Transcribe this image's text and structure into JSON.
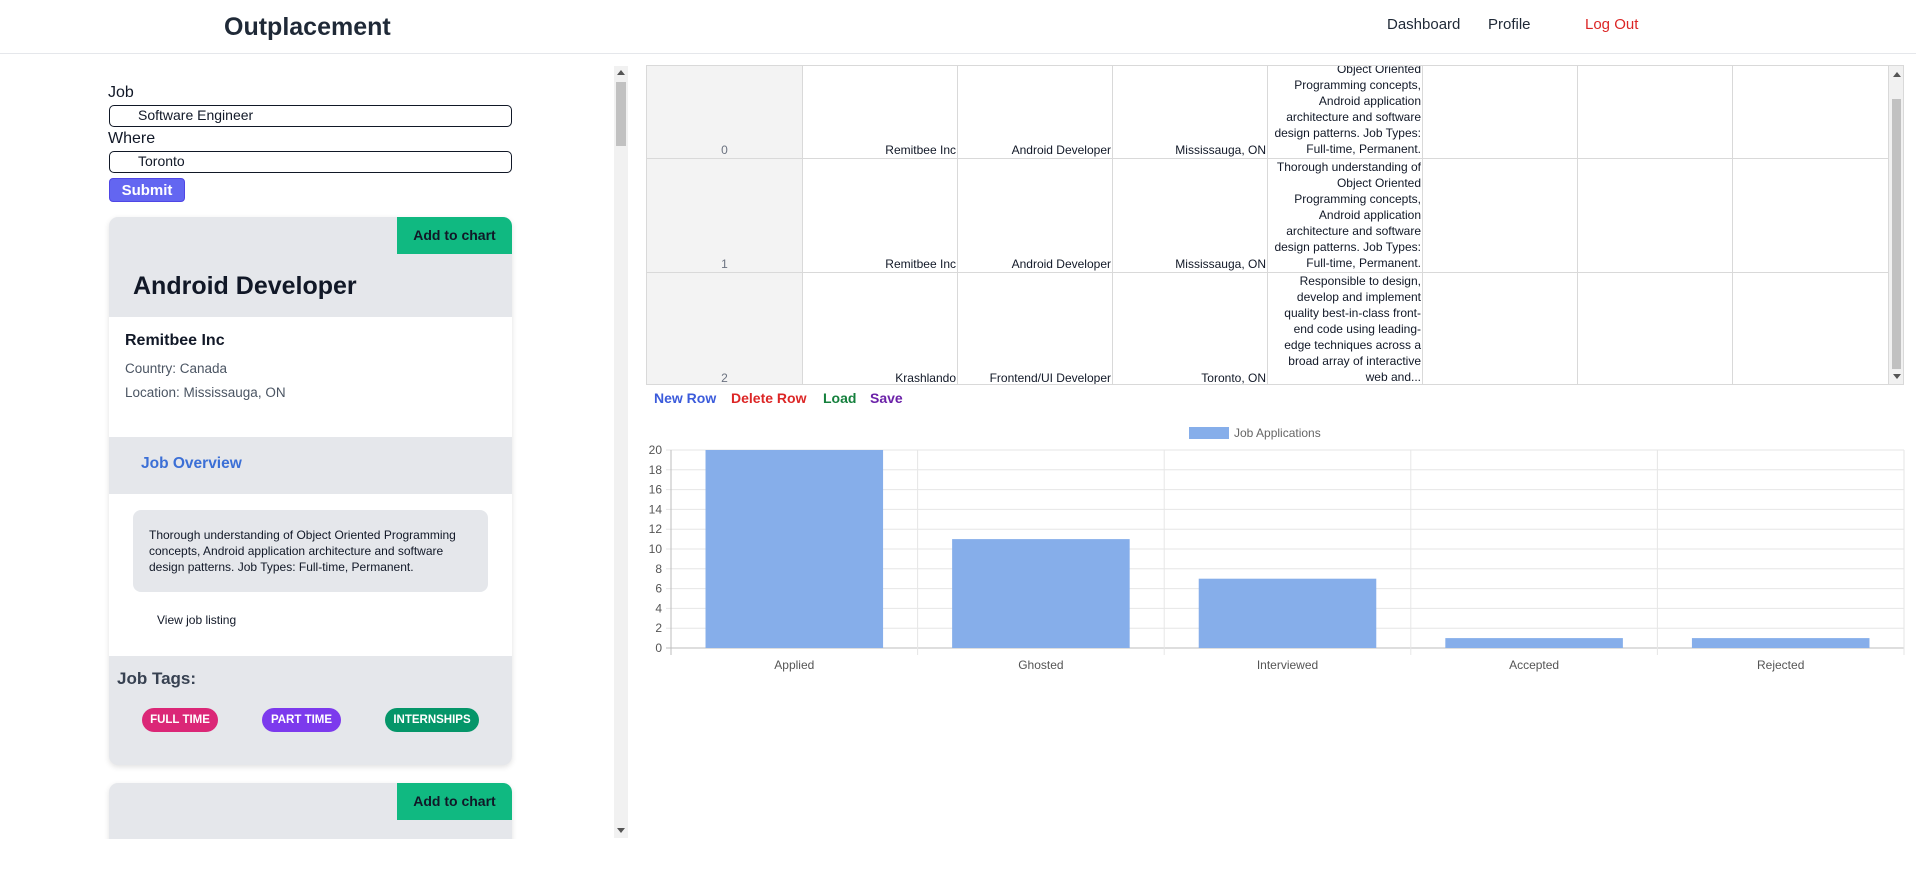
{
  "header": {
    "brand": "Outplacement",
    "nav": [
      "Dashboard",
      "Profile",
      "Log Out"
    ]
  },
  "search": {
    "job_label": "Job",
    "job_value": "Software Engineer",
    "where_label": "Where",
    "where_value": "Toronto",
    "submit_label": "Submit"
  },
  "cards": [
    {
      "add_label": "Add to chart",
      "title": "Android Developer",
      "company": "Remitbee Inc",
      "country": "Country: Canada",
      "location": "Location: Mississauga, ON",
      "overview_title": "Job Overview",
      "description": "Thorough understanding of Object Oriented Programming concepts, Android application architecture and software design patterns. Job Types: Full-time, Permanent.",
      "view_link": "View job listing",
      "tags_title": "Job Tags:",
      "tags": [
        {
          "label": "FULL TIME",
          "color": "#db2777"
        },
        {
          "label": "PART TIME",
          "color": "#7c3aed"
        },
        {
          "label": "INTERNSHIPS",
          "color": "#059669"
        }
      ]
    },
    {
      "add_label": "Add to chart"
    }
  ],
  "grid": {
    "rows": [
      {
        "index": "0",
        "company": "Remitbee Inc",
        "title": "Android Developer",
        "location": "Mississauga, ON",
        "description": "Object Oriented Programming concepts, Android application architecture and software design patterns. Job Types: Full-time, Permanent."
      },
      {
        "index": "1",
        "company": "Remitbee Inc",
        "title": "Android Developer",
        "location": "Mississauga, ON",
        "description": "Thorough understanding of Object Oriented Programming concepts, Android application architecture and software design patterns. Job Types: Full-time, Permanent."
      },
      {
        "index": "2",
        "company": "Krashlando",
        "title": "Frontend/UI Developer",
        "location": "Toronto, ON",
        "description": "Responsible to design, develop and implement quality best-in-class front-end code using leading-edge techniques across a broad array of interactive web and..."
      }
    ],
    "actions": [
      {
        "label": "New Row",
        "color": "#3b5bdb"
      },
      {
        "label": "Delete Row",
        "color": "#dc2626"
      },
      {
        "label": "Load",
        "color": "#15803d"
      },
      {
        "label": "Save",
        "color": "#6b21a8"
      }
    ]
  },
  "chart_data": {
    "type": "bar",
    "categories": [
      "Applied",
      "Ghosted",
      "Interviewed",
      "Accepted",
      "Rejected"
    ],
    "series": [
      {
        "name": "Job Applications",
        "values": [
          20,
          11,
          7,
          1,
          1
        ],
        "color": "#86aeea"
      }
    ],
    "ylim": [
      0,
      20
    ],
    "yticks": [
      0,
      2,
      4,
      6,
      8,
      10,
      12,
      14,
      16,
      18,
      20
    ],
    "legend": "top",
    "grid": true
  }
}
